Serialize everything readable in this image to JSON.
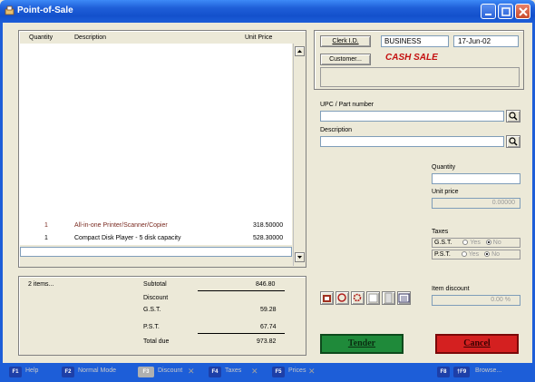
{
  "window": {
    "title": "Point-of-Sale"
  },
  "items_table": {
    "headers": {
      "quantity": "Quantity",
      "description": "Description",
      "unit_price": "Unit Price"
    },
    "rows": [
      {
        "quantity": "1",
        "description": "All-in-one Printer/Scanner/Copier",
        "unit_price": "318.50000",
        "color": "#7a2a20"
      },
      {
        "quantity": "1",
        "description": "Compact Disk Player - 5 disk capacity",
        "unit_price": "528.30000",
        "color": "#000000"
      }
    ]
  },
  "totals": {
    "items_count": "2 items...",
    "subtotal_label": "Subtotal",
    "subtotal": "846.80",
    "discount_label": "Discount",
    "gst_label": "G.S.T.",
    "gst": "59.28",
    "pst_label": "P.S.T.",
    "pst": "67.74",
    "total_label": "Total due",
    "total": "973.82"
  },
  "header": {
    "clerk_button": "Clerk I.D.",
    "clerk_value": "BUSINESS",
    "date": "17-Jun-02",
    "customer_button": "Customer...",
    "customer_value": "CASH SALE"
  },
  "lookup": {
    "upc_label": "UPC / Part number",
    "description_label": "Description",
    "quantity_label": "Quantity",
    "unit_price_label": "Unit price",
    "unit_price_value": "0.00000",
    "taxes_label": "Taxes",
    "gst_label": "G.S.T.",
    "pst_label": "P.S.T.",
    "yes": "Yes",
    "no": "No",
    "item_discount_label": "Item discount",
    "item_discount_value": "0.00 %"
  },
  "actions": {
    "tender": "Tender",
    "cancel": "Cancel"
  },
  "fkeys": {
    "f1": "F1",
    "help": "Help",
    "f2": "F2",
    "normal_mode": "Normal Mode",
    "f3": "F3",
    "discount": "Discount",
    "f4": "F4",
    "taxes": "Taxes",
    "f5": "F5",
    "prices": "Prices",
    "f8": "F8",
    "f9": "†F9",
    "browse": "Browse..."
  },
  "colors": {
    "titlebar": "#1d5ed8",
    "tender": "#1f8a3a",
    "cancel": "#d42020",
    "cash_sale": "#c41010",
    "fkey_bg": "#1d3fa8"
  }
}
